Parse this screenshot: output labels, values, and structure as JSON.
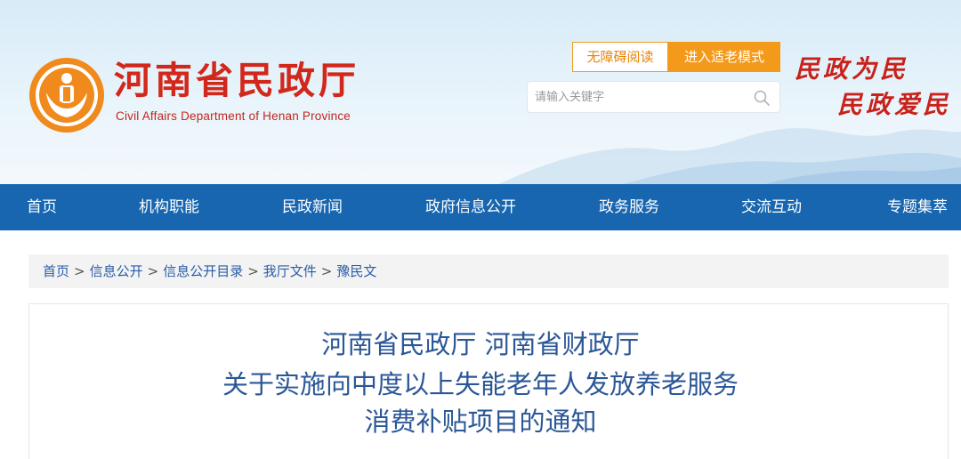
{
  "header": {
    "site_name": "河南省民政厅",
    "site_name_en": "Civil Affairs Department of Henan Province",
    "accessibility_button": "无障碍阅读",
    "elder_mode_button": "进入适老模式",
    "search_placeholder": "请输入关键字",
    "slogan_line1": "民政为民",
    "slogan_line2": "民政爱民",
    "logo_icon": "henan-civil-affairs-emblem",
    "brand_red": "#d2281b",
    "accent_orange": "#f39a1b"
  },
  "nav": {
    "color": "#1766af",
    "items": [
      "首页",
      "机构职能",
      "民政新闻",
      "政府信息公开",
      "政务服务",
      "交流互动",
      "专题集萃"
    ]
  },
  "breadcrumb": [
    "首页",
    "信息公开",
    "信息公开目录",
    "我厅文件",
    "豫民文"
  ],
  "article": {
    "title_line1": "河南省民政厅 河南省财政厅",
    "title_line2": "关于实施向中度以上失能老年人发放养老服务",
    "title_line3": "消费补贴项目的通知"
  }
}
